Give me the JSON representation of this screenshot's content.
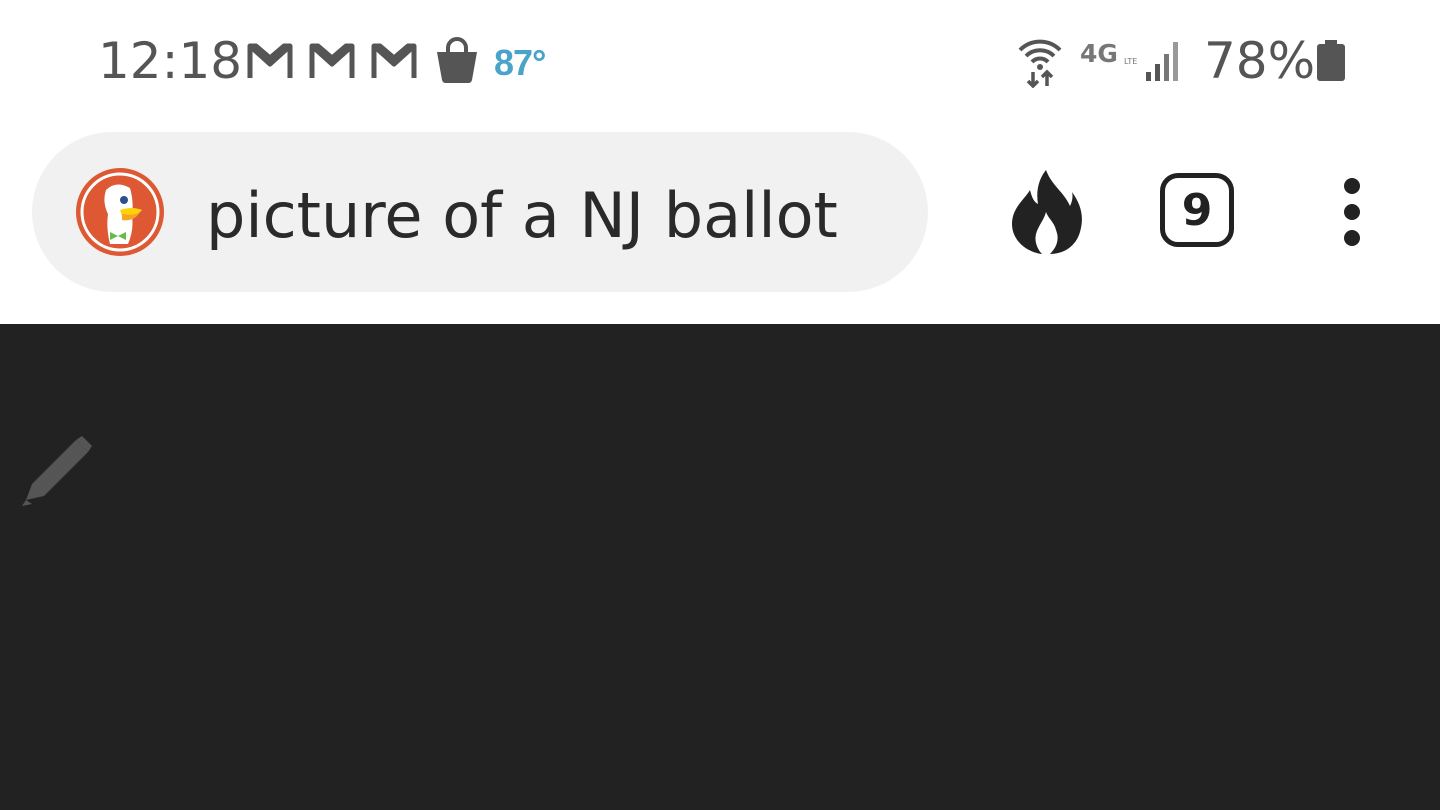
{
  "status_bar": {
    "time": "12:18",
    "notification_icons": [
      "gmail-icon",
      "gmail-icon",
      "gmail-icon",
      "shopping-bag-icon"
    ],
    "temperature": "87°",
    "network_label": "4G LTE",
    "battery_percent": "78%",
    "temperature_color": "#4aa3c8"
  },
  "browser": {
    "query": "picture of a NJ ballot",
    "tab_count": "9",
    "icons": {
      "logo": "duckduckgo-logo-icon",
      "fire": "fire-icon",
      "tabs": "tab-switcher-icon",
      "menu": "more-vert-icon"
    }
  },
  "content": {
    "background": "#222222",
    "icon": "pencil-icon"
  }
}
